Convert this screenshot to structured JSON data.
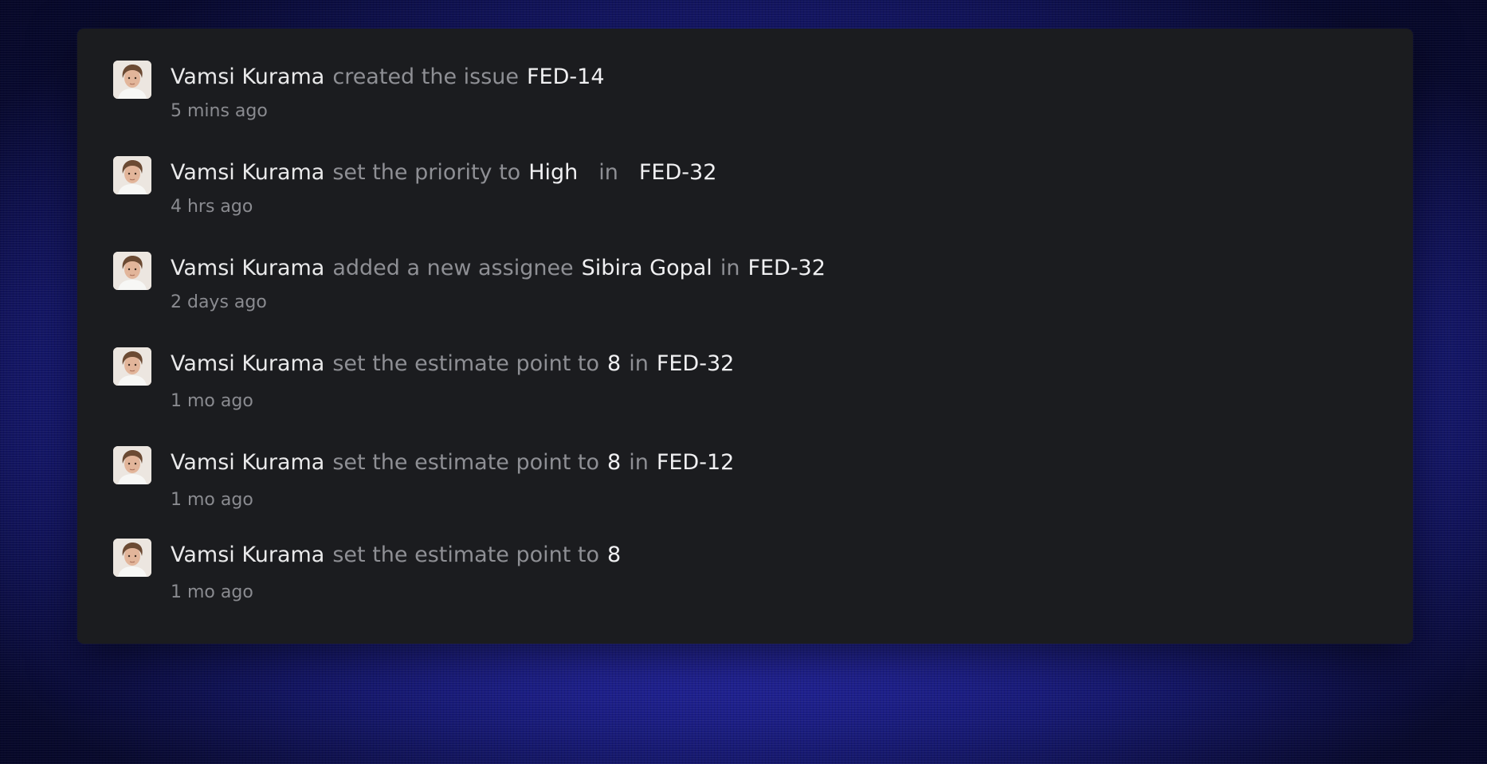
{
  "activity": [
    {
      "actor": "Vamsi Kurama",
      "parts": [
        {
          "text": "created the issue",
          "kind": "verb"
        },
        {
          "text": "FED-14",
          "kind": "hl"
        }
      ],
      "time": "5 mins ago"
    },
    {
      "actor": "Vamsi Kurama",
      "parts": [
        {
          "text": "set the priority to",
          "kind": "verb"
        },
        {
          "text": "High",
          "kind": "hl"
        },
        {
          "text": "in",
          "kind": "verb"
        },
        {
          "text": "FED-32",
          "kind": "hl"
        }
      ],
      "time": "4 hrs ago"
    },
    {
      "actor": "Vamsi Kurama",
      "parts": [
        {
          "text": "added a new assignee",
          "kind": "verb"
        },
        {
          "text": "Sibira Gopal",
          "kind": "hl"
        },
        {
          "text": "in",
          "kind": "verb"
        },
        {
          "text": "FED-32",
          "kind": "hl"
        }
      ],
      "time": "2 days ago"
    },
    {
      "actor": "Vamsi Kurama",
      "parts": [
        {
          "text": "set the estimate point to",
          "kind": "verb"
        },
        {
          "text": "8",
          "kind": "hl"
        },
        {
          "text": "in",
          "kind": "verb"
        },
        {
          "text": "FED-32",
          "kind": "hl"
        }
      ],
      "time": "1 mo ago"
    },
    {
      "actor": "Vamsi Kurama",
      "parts": [
        {
          "text": "set the estimate point to",
          "kind": "verb"
        },
        {
          "text": "8",
          "kind": "hl"
        },
        {
          "text": "in",
          "kind": "verb"
        },
        {
          "text": "FED-12",
          "kind": "hl"
        }
      ],
      "time": "1 mo ago"
    },
    {
      "actor": "Vamsi Kurama",
      "parts": [
        {
          "text": "set the estimate point to",
          "kind": "verb"
        },
        {
          "text": "8",
          "kind": "hl"
        }
      ],
      "time": "1 mo ago"
    }
  ],
  "icons": {
    "avatar": "user-avatar-icon"
  }
}
